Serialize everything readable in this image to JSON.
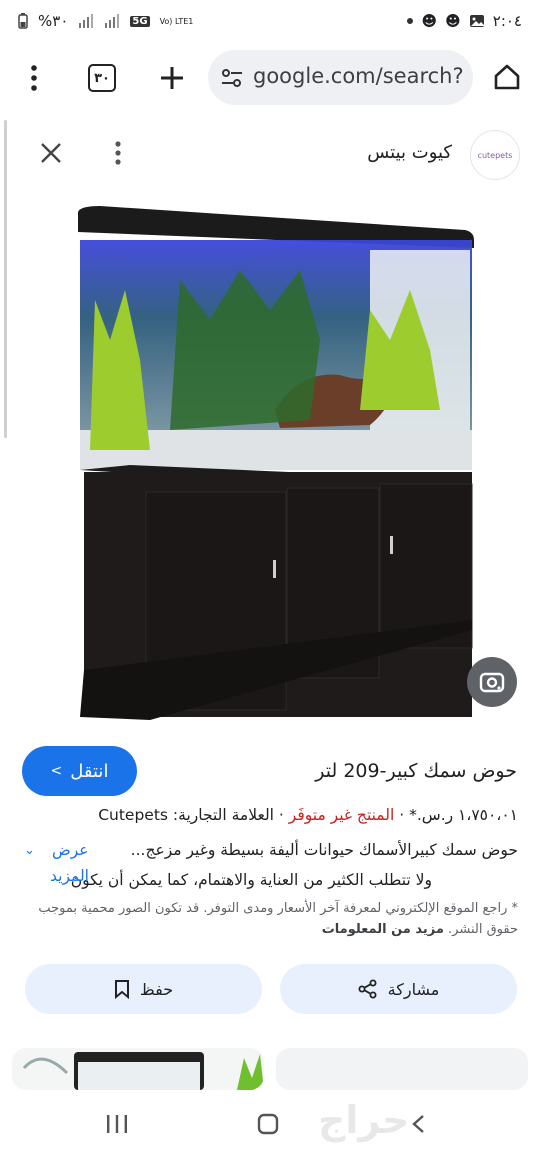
{
  "status_bar": {
    "battery": "%٣٠",
    "network": "5G",
    "volte": "Vo) LTE1",
    "time": "٢:٠٤"
  },
  "browser": {
    "tab_count": "٣٠",
    "url": "google.com/search?"
  },
  "result": {
    "site_name": "كيوت بيتس",
    "logo_text": "cutepets",
    "go_label": "انتقل",
    "title": "حوض سمك كبير-209 لتر",
    "price": "١،٧٥٠،٠١ ر.س.*",
    "availability": "المنتج غير متوفَر",
    "brand": "العلامة التجارية: Cutepets",
    "description_line1": "حوض سمك كبيرالأسماك حيوانات أليفة بسيطة وغير مزعج...",
    "description_line2": "ولا تتطلب الكثير من العناية والاهتمام، كما يمكن أن يكون",
    "show_more_line1": "عرض",
    "show_more_line2": "المزيد",
    "note_text": "* راجع الموقع الإلكتروني لمعرفة آخر الأسعار ومدى التوفر. قد تكون الصور محمية بموجب حقوق النشر.",
    "note_link": "مزيد من المعلومات",
    "share_label": "مشاركة",
    "save_label": "حفظ"
  },
  "watermark": "حراج",
  "colors": {
    "accent": "#1a73e8",
    "unavailable": "#c5221f",
    "chip_bg": "#e8f0fe"
  }
}
